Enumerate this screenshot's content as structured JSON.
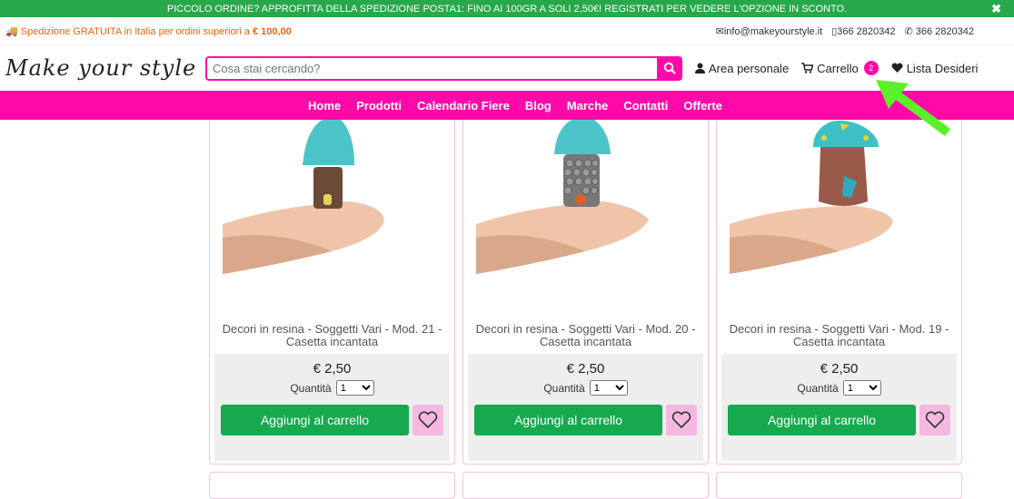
{
  "promo": {
    "text": "PICCOLO ORDINE? APPROFITTA DELLA SPEDIZIONE POSTA1: FINO AI 100GR A SOLI 2,50€! REGISTRATI PER VEDERE L'OPZIONE IN SCONTO.",
    "close": "✖"
  },
  "info": {
    "shipping_text": "Spedizione GRATUITA in Italia per ordini superiori a",
    "shipping_amount": "€ 100,00",
    "email": "info@makeyourstyle.it",
    "phone": "366 2820342",
    "whatsapp": "366 2820342"
  },
  "header": {
    "logo": "Make your style",
    "search_placeholder": "Cosa stai cercando?",
    "account": "Area personale",
    "cart": "Carrello",
    "cart_count": "2",
    "wishlist": "Lista Desideri"
  },
  "nav": [
    "Home",
    "Prodotti",
    "Calendario Fiere",
    "Blog",
    "Marche",
    "Contatti",
    "Offerte"
  ],
  "products": [
    {
      "title": "Decori in resina - Soggetti Vari - Mod. 21 - Casetta incantata",
      "price": "€ 2,50",
      "qty_label": "Quantità",
      "qty": "1",
      "add": "Aggiungi al carrello",
      "trunk": "#6b4a36"
    },
    {
      "title": "Decori in resina - Soggetti Vari - Mod. 20 - Casetta incantata",
      "price": "€ 2,50",
      "qty_label": "Quantità",
      "qty": "1",
      "add": "Aggiungi al carrello",
      "trunk": "#777777"
    },
    {
      "title": "Decori in resina - Soggetti Vari - Mod. 19 - Casetta incantata",
      "price": "€ 2,50",
      "qty_label": "Quantità",
      "qty": "1",
      "add": "Aggiungi al carrello",
      "trunk": "#9a5a4a"
    }
  ],
  "colors": {
    "accent": "#ff0aa8",
    "green": "#17a94e",
    "promo": "#27a84a"
  }
}
